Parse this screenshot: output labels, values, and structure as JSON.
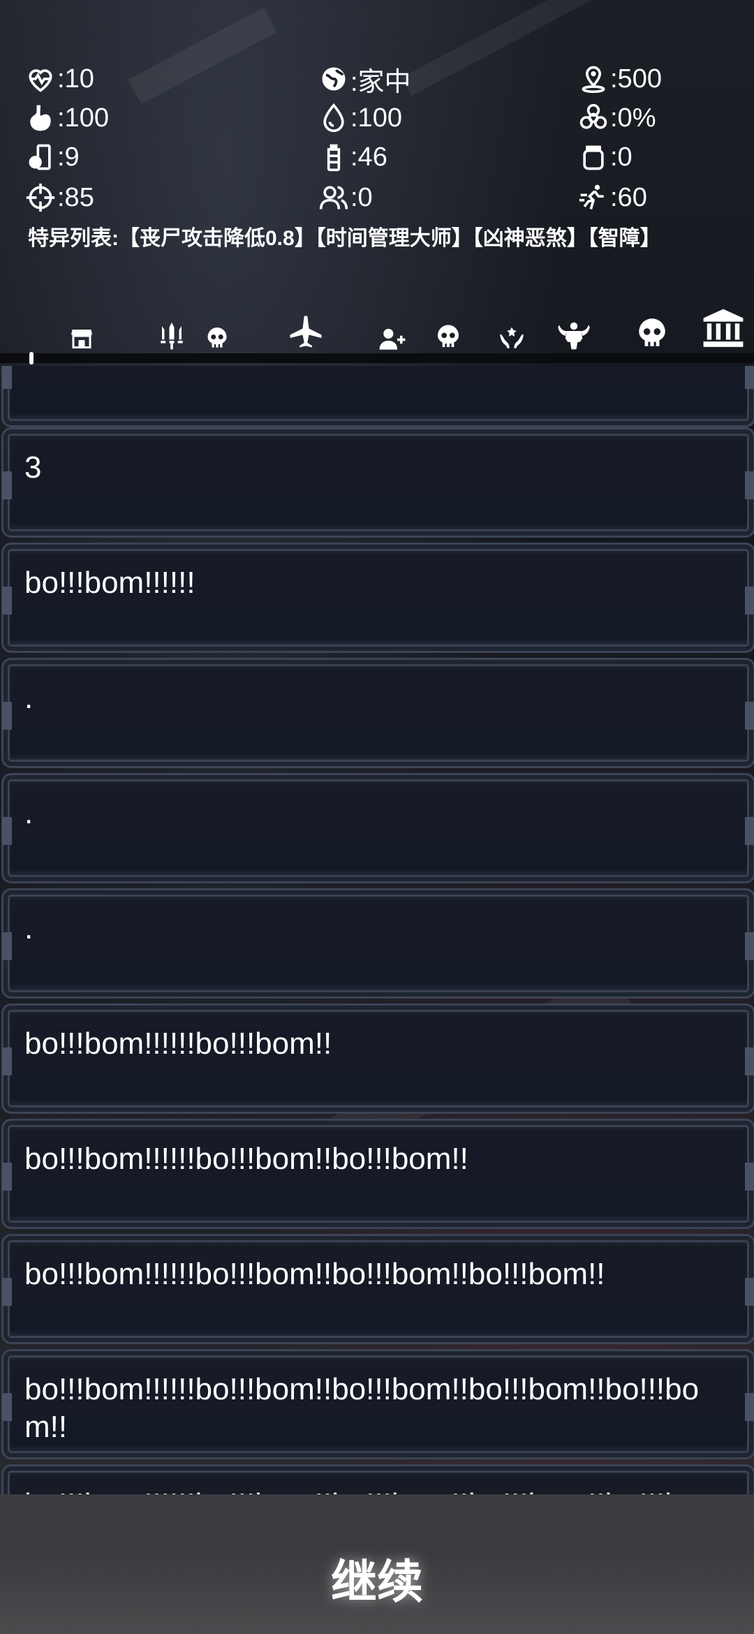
{
  "stats": {
    "health": ":10",
    "location": ":家中",
    "distance": ":500",
    "hunger": ":100",
    "thirst": ":100",
    "infection": ":0%",
    "food": ":9",
    "water": ":46",
    "medicine": ":0",
    "accuracy": ":85",
    "companions": ":0",
    "speed": ":60"
  },
  "traits": "特异列表:【丧尸攻击降低0.8】【时间管理大师】【凶神恶煞】【智障】",
  "toolbar": {
    "icons": [
      "shop-icon",
      "weapons-icon",
      "skull-icon",
      "plane-icon",
      "add-user-icon",
      "skull-icon",
      "heal-icon",
      "strength-icon",
      "skull-icon",
      "bank-icon"
    ]
  },
  "messages": [
    "",
    "3",
    "bo!!!bom!!!!!!",
    ".",
    ".",
    ".",
    "bo!!!bom!!!!!!bo!!!bom!!",
    "bo!!!bom!!!!!!bo!!!bom!!bo!!!bom!!",
    "bo!!!bom!!!!!!bo!!!bom!!bo!!!bom!!bo!!!bom!!",
    "bo!!!bom!!!!!!bo!!!bom!!bo!!!bom!!bo!!!bom!!bo!!!bom!!",
    "bo!!!bom!!!!!!bo!!!bom!!bo!!!bom!!bo!!!bom!!bo!!!bom!!bo!!!bom!!"
  ],
  "continue_label": "继续"
}
